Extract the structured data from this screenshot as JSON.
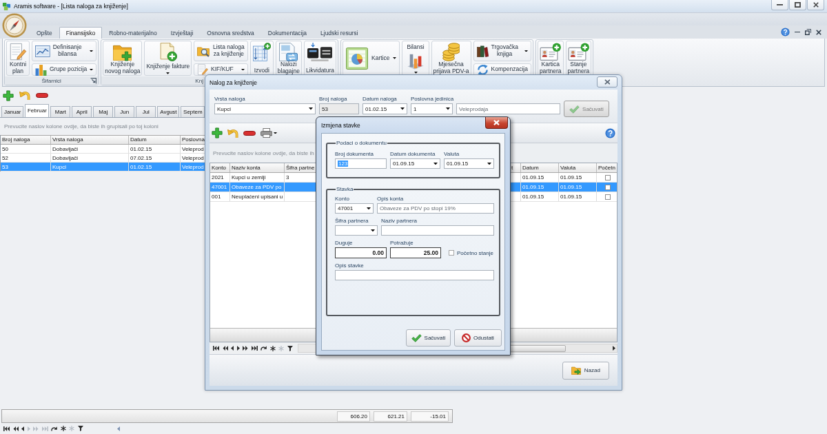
{
  "window": {
    "title": "Aramis software - [Lista naloga za knjiženje]"
  },
  "ribbon": {
    "tabs": [
      {
        "label": "Opšte",
        "selected": false
      },
      {
        "label": "Finansijsko",
        "selected": true
      },
      {
        "label": "Robno-materijalno",
        "selected": false
      },
      {
        "label": "Izvještaji",
        "selected": false
      },
      {
        "label": "Osnovna sredstva",
        "selected": false
      },
      {
        "label": "Dokumentacija",
        "selected": false
      },
      {
        "label": "Ljudski resursi",
        "selected": false
      }
    ],
    "groups": [
      {
        "label": "Šifarnici",
        "launcher": true,
        "items": [
          {
            "kind": "large",
            "label": "Kontni\nplan",
            "dropdown": false
          },
          {
            "kind": "stack",
            "items": [
              {
                "label": "Definisanje\nbilansa",
                "dropdown": true
              },
              {
                "label": "Grupe pozicija",
                "dropdown": true
              }
            ]
          }
        ]
      },
      {
        "label": "Knj",
        "items": [
          {
            "kind": "large",
            "label": "Knjiženje\nnovog naloga",
            "dropdown": false
          },
          {
            "kind": "large",
            "label": "Knjiženje fakture",
            "dropdown": true
          },
          {
            "kind": "stack",
            "items": [
              {
                "label": "Lista naloga\nza knjiženje",
                "dropdown": false
              },
              {
                "label": "KIF/KUF",
                "dropdown": true
              }
            ]
          },
          {
            "kind": "large",
            "label": "Izvodi",
            "dropdown": false
          },
          {
            "kind": "large",
            "label": "Nalozi\nblagajne",
            "dropdown": false
          },
          {
            "kind": "large",
            "label": "Likvidatura",
            "dropdown": false
          }
        ]
      },
      {
        "items": [
          {
            "kind": "wide",
            "label": "Kartice",
            "dropdown": true
          },
          {
            "kind": "top-label",
            "label": "Bilansi",
            "dropdown": true
          },
          {
            "kind": "large",
            "label": "Mjesečna\nprijava PDV-a",
            "dropdown": false
          },
          {
            "kind": "stack",
            "items": [
              {
                "label": "Trgovačka\nknjiga",
                "dropdown": true
              },
              {
                "label": "Kompenzacija",
                "dropdown": false
              }
            ]
          }
        ]
      },
      {
        "items": [
          {
            "kind": "large",
            "label": "Kartica\npartnera",
            "dropdown": false
          },
          {
            "kind": "large",
            "label": "Stanje\npartnera",
            "dropdown": false
          }
        ]
      }
    ]
  },
  "month_tabs": [
    {
      "label": "Januar",
      "selected": false
    },
    {
      "label": "Februar",
      "selected": true
    },
    {
      "label": "Mart",
      "selected": false
    },
    {
      "label": "April",
      "selected": false
    },
    {
      "label": "Maj",
      "selected": false
    },
    {
      "label": "Jun",
      "selected": false
    },
    {
      "label": "Jul",
      "selected": false
    },
    {
      "label": "Avgust",
      "selected": false
    },
    {
      "label": "Septem",
      "selected": false
    }
  ],
  "group_panel": {
    "hint": "Prevucite naslov kolone ovdje, da biste ih grupisali po toj koloni"
  },
  "orders_table": {
    "columns": [
      "Broj naloga",
      "Vrsta naloga",
      "Datum",
      "Poslovna"
    ],
    "rows": [
      {
        "cells": [
          "50",
          "Dobavljači",
          "01.02.15",
          "Veleprod"
        ],
        "selected": false
      },
      {
        "cells": [
          "52",
          "Dobavljači",
          "07.02.15",
          "Veleprod"
        ],
        "selected": false
      },
      {
        "cells": [
          "53",
          "Kupci",
          "01.02.15",
          "Veleprod"
        ],
        "selected": true
      }
    ]
  },
  "summary": {
    "values": [
      "606.20",
      "621.21",
      "-15.01"
    ]
  },
  "navigator": {
    "buttons": [
      {
        "disabled": false
      },
      {
        "disabled": false
      },
      {
        "disabled": false
      },
      {
        "disabled": true
      },
      {
        "disabled": true
      },
      {
        "disabled": true
      },
      {
        "disabled": false
      },
      {
        "disabled": false
      },
      {
        "disabled": true
      },
      {
        "disabled": false
      }
    ]
  },
  "order_dialog": {
    "title": "Nalog za knjiženje",
    "fields": [
      {
        "label": "Vrsta naloga",
        "value": "Kupci",
        "kind": "dropdown"
      },
      {
        "label": "Broj naloga",
        "value": "53",
        "kind": "locked"
      },
      {
        "label": "Datum naloga",
        "value": "01.02.15",
        "kind": "dropdown"
      },
      {
        "label": "Poslovna jedinica",
        "value": "1",
        "kind": "dropdown"
      },
      {
        "value": "Veleprodaja",
        "kind": "readonly"
      }
    ],
    "save_button": {
      "label": "Sačuvati",
      "disabled": true
    },
    "group_panel": {
      "hint": "Prevucite naslov kolone ovdje, da biste ih"
    },
    "table": {
      "columns": [
        "Konto",
        "Naziv konta",
        "Šifra partne",
        "t",
        "Datum",
        "Valuta",
        "Početn"
      ],
      "rows": [
        {
          "konto": "2021",
          "naziv_konta": "Kupci u zemlji",
          "sifra_partnera": "3",
          "datum": "01.09.15",
          "valuta": "01.09.15",
          "pocetno_stanje": false,
          "selected": false
        },
        {
          "konto": "47001",
          "naziv_konta": "Obaveze za PDV po",
          "datum": "01.09.15",
          "valuta": "01.09.15",
          "pocetno_stanje": false,
          "selected": true
        },
        {
          "konto": "001",
          "naziv_konta": "Neuplaćeni upisani u",
          "datum": "01.09.15",
          "valuta": "01.09.15",
          "pocetno_stanje": false,
          "selected": false
        }
      ]
    },
    "navigator": {
      "buttons": [
        {
          "disabled": false
        },
        {
          "disabled": false
        },
        {
          "disabled": false
        },
        {
          "disabled": false
        },
        {
          "disabled": false
        },
        {
          "disabled": false
        },
        {
          "disabled": false
        },
        {
          "disabled": false
        },
        {
          "disabled": true
        },
        {
          "disabled": false
        }
      ]
    },
    "back_button": {
      "label": "Nazad"
    }
  },
  "edit_dialog": {
    "title": "Izmjena stavke",
    "document_group": {
      "title": "Podaci o dokumentu",
      "fields": [
        {
          "label": "Broj dokumenta",
          "value": "123",
          "kind": "text",
          "text_selected": true
        },
        {
          "label": "Datum dokumenta",
          "value": "01.09.15",
          "kind": "dropdown",
          "text_selected": false
        },
        {
          "label": "Valuta",
          "value": "01.09.15",
          "kind": "dropdown",
          "text_selected": false
        }
      ]
    },
    "item_group": {
      "title": "Stavka",
      "rows": [
        {
          "fields": [
            {
              "label": "Konto",
              "value": "47001",
              "kind": "dropdown"
            },
            {
              "label": "Opis konta",
              "value": "Obaveze za PDV po stopi 19%",
              "kind": "readonly"
            }
          ]
        },
        {
          "fields": [
            {
              "label": "Šifra partnera",
              "kind": "dropdown"
            },
            {
              "label": "Naziv partnera",
              "kind": "text"
            }
          ]
        },
        {
          "fields": [
            {
              "label": "Duguje",
              "value": "0.00",
              "kind": "amount"
            },
            {
              "label": "Potražuje",
              "value": "25.00",
              "kind": "amount"
            },
            {
              "label": "Početno stanje",
              "kind": "checkbox",
              "checked": false
            }
          ]
        },
        {
          "fields": [
            {
              "label": "Opis stavke",
              "kind": "text"
            }
          ]
        }
      ]
    },
    "buttons": [
      {
        "label": "Sačuvati",
        "kind": "save"
      },
      {
        "label": "Odustati",
        "kind": "cancel"
      }
    ]
  }
}
